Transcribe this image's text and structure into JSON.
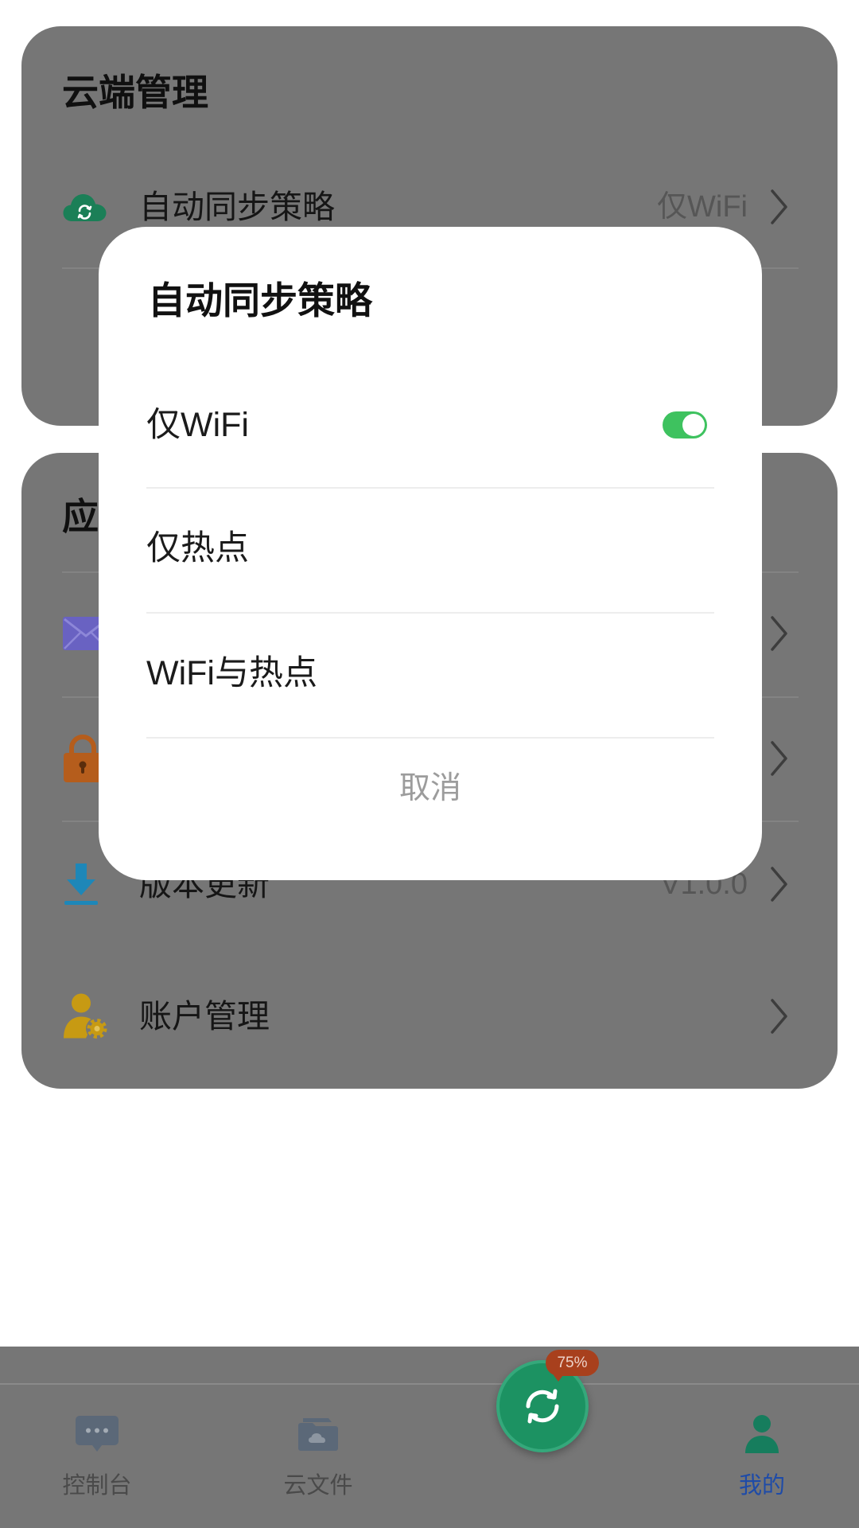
{
  "cloud_section": {
    "title": "云端管理",
    "rows": [
      {
        "icon": "cloud-sync-icon",
        "label": "自动同步策略",
        "value": "仅WiFi"
      }
    ]
  },
  "app_section": {
    "title": "应",
    "rows": [
      {
        "icon": "mail-icon"
      },
      {
        "icon": "lock-icon"
      },
      {
        "icon": "download-icon",
        "label": "版本更新",
        "value": "V1.0.0"
      },
      {
        "icon": "user-settings-icon",
        "label": "账户管理"
      }
    ]
  },
  "dialog": {
    "title": "自动同步策略",
    "options": [
      {
        "label": "仅WiFi",
        "selected": true
      },
      {
        "label": "仅热点",
        "selected": false
      },
      {
        "label": "WiFi与热点",
        "selected": false
      }
    ],
    "cancel_label": "取消"
  },
  "bottom_nav": {
    "items": [
      {
        "label": "控制台",
        "icon": "console-chat-icon",
        "active": false
      },
      {
        "label": "云文件",
        "icon": "cloud-folder-icon",
        "active": false
      },
      {
        "label": "我的",
        "icon": "profile-icon",
        "active": true
      }
    ],
    "sync_button": {
      "icon": "sync-icon",
      "badge": "75%"
    }
  },
  "colors": {
    "toggle_on": "#3EC25F",
    "active_tab": "#1E4BA8",
    "sync_button": "#1C9262",
    "badge": "#A8401D",
    "card_dimmed": "#767676",
    "dialog_bg": "#FFFFFF"
  }
}
